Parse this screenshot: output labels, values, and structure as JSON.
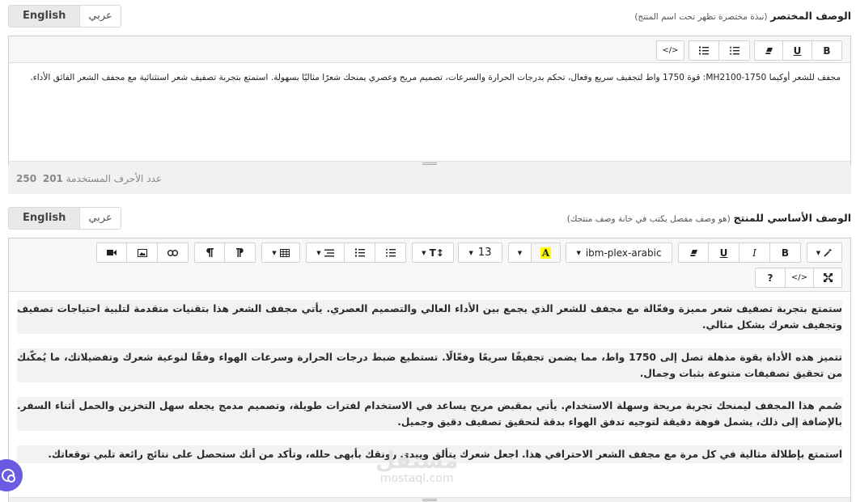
{
  "short_description": {
    "label": "الوصف المختصر",
    "hint": "(نبذة مختصرة تظهر تحت اسم المنتج)",
    "lang_active": "English",
    "lang_other": "عربي",
    "toolbar": {
      "bold": "B",
      "underline": "U",
      "code": "</>"
    },
    "text": "مجفف للشعر أوكيما 1750-MH2100: قوة 1750 واط لتجفيف سريع وفعال، تحكم بدرجات الحرارة والسرعات، تصميم مريح وعصري يمنحك شعرًا مثاليًا بسهولة. استمتع بتجربة تصفيف شعر استثنائية مع مجفف الشعر الفائق الأداء.",
    "counter_label": "عدد الأحرف المستخدمة",
    "counter_used": "201",
    "counter_max": "250"
  },
  "main_description": {
    "label": "الوصف الأساسي للمنتج",
    "hint": "(هو وصف مفصل يكتب في خانة وصف منتجك)",
    "lang_active": "English",
    "lang_other": "عربي",
    "toolbar": {
      "bold": "B",
      "italic": "I",
      "underline": "U",
      "font_family": "ibm-plex-arabic",
      "font_color": "A",
      "font_size": "13",
      "text_height": "T↕",
      "help": "?",
      "code": "</>"
    },
    "paragraphs": [
      "ستمتع بتجربة تصفيف شعر مميزة وفعّالة مع مجفف للشعر الذي يجمع بين الأداء العالي والتصميم العصري. يأتي مجفف الشعر هذا بتقنيات متقدمة لتلبية احتياجات تصفيف وتجفيف شعرك بشكل مثالي.",
      "تتميز هذه الأداة بقوة مذهلة تصل إلى 1750 واط، مما يضمن تجفيفًا سريعًا وفعّالًا. تستطيع ضبط درجات الحرارة وسرعات الهواء وفقًا لنوعية شعرك وتفضيلاتك، ما يُمكّنك من تحقيق تصفيفات متنوعة بثبات وجمال.",
      "صُمم هذا المجفف ليمنحك تجربة مريحة وسهلة الاستخدام. يأتي بمقبض مريح يساعد في الاستخدام لفترات طويلة، وتصميم مدمج يجعله سهل التخزين والحمل أثناء السفر. بالإضافة إلى ذلك، يشمل فوهة دقيقة لتوجيه تدفق الهواء بدقة لتحقيق تصفيف دقيق وجميل.",
      "استمتع بإطلالة مثالية في كل مرة مع مجفف الشعر الاحترافي هذا. اجعل شعرك يتألق ويبدي رونقك بأبهى حلله، وتأكد من أنك ستحصل على نتائج رائعة تلبي توقعاتك."
    ]
  },
  "watermark": {
    "logo": "مستقل",
    "url": "mostaql.com"
  },
  "colors": {
    "accent": "#6a5be2",
    "highlight": "#ffff00"
  }
}
